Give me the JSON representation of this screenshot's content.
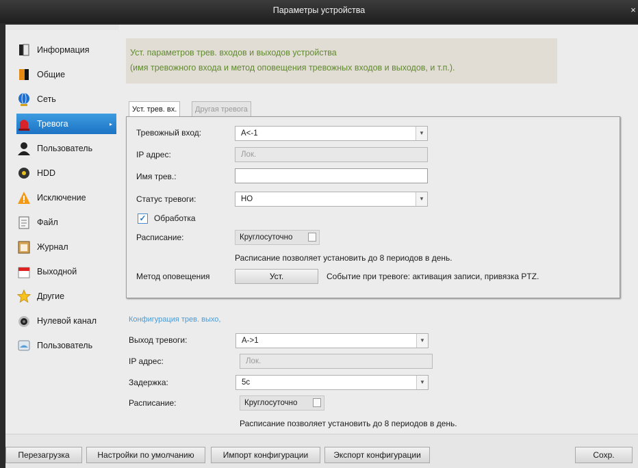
{
  "window": {
    "title": "Параметры устройства",
    "close": "×"
  },
  "sidebar": {
    "items": [
      {
        "label": "Информация",
        "icon": "info-book-icon"
      },
      {
        "label": "Общие",
        "icon": "general-book-icon"
      },
      {
        "label": "Сеть",
        "icon": "network-globe-icon"
      },
      {
        "label": "Тревога",
        "icon": "alarm-siren-icon",
        "active": true,
        "arrow": "▸"
      },
      {
        "label": "Пользователь",
        "icon": "user-icon"
      },
      {
        "label": "HDD",
        "icon": "hdd-icon"
      },
      {
        "label": "Исключение",
        "icon": "warning-icon"
      },
      {
        "label": "Файл",
        "icon": "file-icon"
      },
      {
        "label": "Журнал",
        "icon": "log-calendar-icon"
      },
      {
        "label": "Выходной",
        "icon": "holiday-calendar-icon"
      },
      {
        "label": "Другие",
        "icon": "star-icon"
      },
      {
        "label": "Нулевой канал",
        "icon": "camera-icon"
      },
      {
        "label": "Пользователь",
        "icon": "user-disk-icon"
      }
    ]
  },
  "info": {
    "line1": "Уст. параметров трев. входов и выходов устройства",
    "line2": "(имя тревожного входа и метод оповещения тревожных входов и выходов, и т.п.)."
  },
  "tabs": [
    {
      "label": "Уст. трев. вх.",
      "active": true
    },
    {
      "label": "Другая тревога",
      "active": false
    }
  ],
  "alarm_input": {
    "input_label": "Тревожный вход:",
    "input_value": "A<-1",
    "ip_label": "IP адрес:",
    "ip_value": "Лок.",
    "name_label": "Имя трев.:",
    "name_value": "",
    "status_label": "Статус тревоги:",
    "status_value": "НО",
    "handling_label": "Обработка",
    "handling_checked": "✓",
    "schedule_label": "Расписание:",
    "schedule_value": "Круглосуточно",
    "schedule_note": "Расписание позволяет установить до 8 периодов в день.",
    "method_label": "Метод оповещения",
    "method_button": "Уст.",
    "method_note": "Событие при тревоге: активация записи, привязка PTZ."
  },
  "alarm_output": {
    "section_title": "Конфигурация трев. выхо,",
    "output_label": "Выход тревоги:",
    "output_value": "A->1",
    "ip_label": "IP адрес:",
    "ip_value": "Лок.",
    "delay_label": "Задержка:",
    "delay_value": "5с",
    "schedule_label": "Расписание:",
    "schedule_value": "Круглосуточно",
    "schedule_note": "Расписание позволяет установить до 8 периодов в день."
  },
  "footer": {
    "reboot": "Перезагрузка",
    "defaults": "Настройки по умолчанию",
    "import": "Импорт конфигурации",
    "export": "Экспорт конфигурации",
    "save": "Сохр."
  },
  "colors": {
    "accent": "#1c73c4",
    "info_text": "#5f8a2e",
    "section_title": "#4a9ad6"
  }
}
